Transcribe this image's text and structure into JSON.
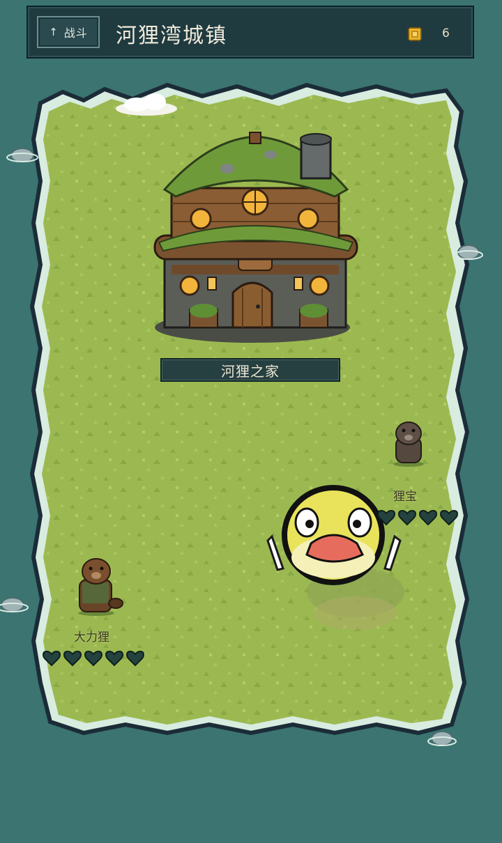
{
  "header": {
    "back_label": "战斗",
    "back_arrow": "↑",
    "title": "河狸湾城镇",
    "coin_count": "6",
    "coin_icon": "coin-icon"
  },
  "map": {
    "house_label": "河狸之家",
    "npcs": [
      {
        "name": "大力狸",
        "hearts_filled": 5,
        "hearts_total": 5
      },
      {
        "name": "狸宝",
        "hearts_filled": 4,
        "hearts_total": 4
      }
    ]
  },
  "colors": {
    "background": "#3b7471",
    "grass": "#9bb84f",
    "panel": "#1f3b40",
    "heart": "#24433f"
  }
}
